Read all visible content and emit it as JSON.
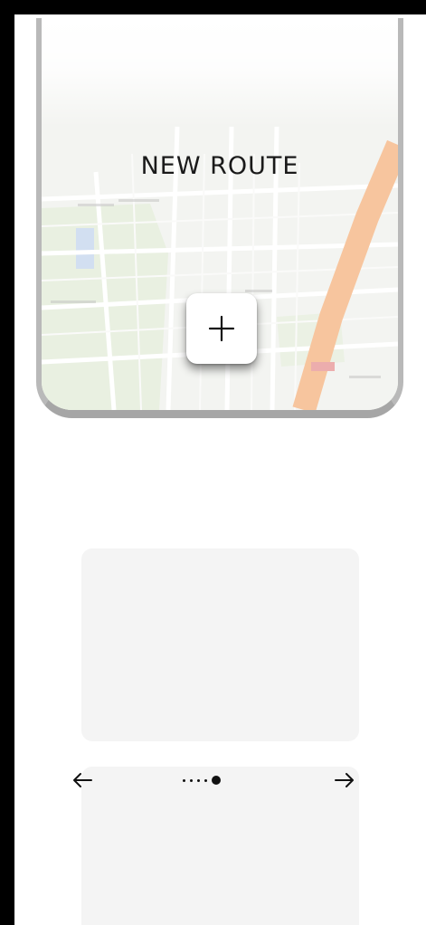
{
  "screen": {
    "title": "NEW ROUTE",
    "add_button_icon": "plus-icon"
  },
  "map": {
    "style": "street-map",
    "colors": {
      "base": "#ecefe8",
      "park": "#d9e6cc",
      "highway": "#f0a060",
      "water": "#aac4e6"
    }
  },
  "pager": {
    "prev_icon": "arrow-left-icon",
    "next_icon": "arrow-right-icon",
    "page_count": 5,
    "current_page": 5
  },
  "colors": {
    "frame": "#000000",
    "card": "#f4f4f4",
    "accent_text": "#1a1a1a"
  }
}
